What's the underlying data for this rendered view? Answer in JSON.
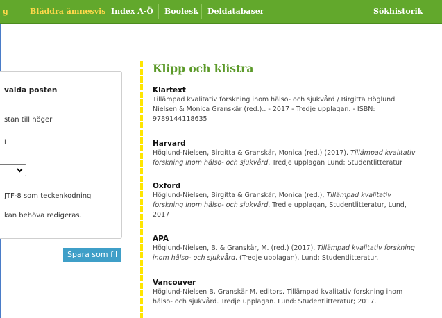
{
  "nav": {
    "items": [
      "g",
      "Bläddra ämnesvis",
      "Index A-Ö",
      "Boolesk",
      "Deldatabaser",
      "Sökhistorik"
    ]
  },
  "export_panel": {
    "heading": "valda posten",
    "line_1": "stan till höger",
    "line_2": "l",
    "select_value": "",
    "line_3": "JTF-8 som teckenkodning",
    "line_4": "kan behöva redigeras.",
    "save_label": "Spara som fil"
  },
  "main": {
    "heading": "Klipp och klistra",
    "citations": [
      {
        "style": "Klartext",
        "lines": [
          [
            "Tillämpad kvalitativ forskning inom hälso- och sjukvård / Birgitta Höglund"
          ],
          [
            "Nielsen & Monica Granskär (red.).. - 2017 - Tredje upplagan. - ISBN:"
          ],
          [
            "9789144118635"
          ]
        ]
      },
      {
        "style": "Harvard",
        "lines": [
          [
            "Höglund-Nielsen, Birgitta & Granskär, Monica (red.) (2017). ",
            "Tillämpad kvalitativ"
          ],
          [
            "",
            "forskning inom hälso- och sjukvård",
            ". Tredje upplagan Lund: Studentlitteratur"
          ]
        ]
      },
      {
        "style": "Oxford",
        "lines": [
          [
            "Höglund-Nielsen, Birgitta & Granskär, Monica (red.), ",
            "Tillämpad kvalitativ"
          ],
          [
            "",
            "forskning inom hälso- och sjukvård",
            ", Tredje upplagan, Studentlitteratur, Lund,"
          ],
          [
            "2017"
          ]
        ]
      },
      {
        "style": "APA",
        "lines": [
          [
            "Höglund-Nielsen, B. & Granskär, M. (red.) (2017). ",
            "Tillämpad kvalitativ forskning"
          ],
          [
            "",
            "inom hälso- och sjukvård",
            ". (Tredje upplagan). Lund: Studentlitteratur."
          ]
        ]
      },
      {
        "style": "Vancouver",
        "lines": [
          [
            "Höglund-Nielsen B, Granskär M, editors. Tillämpad kvalitativ forskning inom"
          ],
          [
            "hälso- och sjukvård. Tredje upplagan. Lund: Studentlitteratur; 2017."
          ]
        ]
      }
    ]
  },
  "colors": {
    "nav_bg": "#62a82c",
    "nav_active": "#ffd84a",
    "heading": "#5c9a2a",
    "button": "#3f9fc8",
    "marker": "#ffe600",
    "frame": "#4a7cc8"
  },
  "icons": {
    "select_arrow": "chevron-down-icon"
  }
}
